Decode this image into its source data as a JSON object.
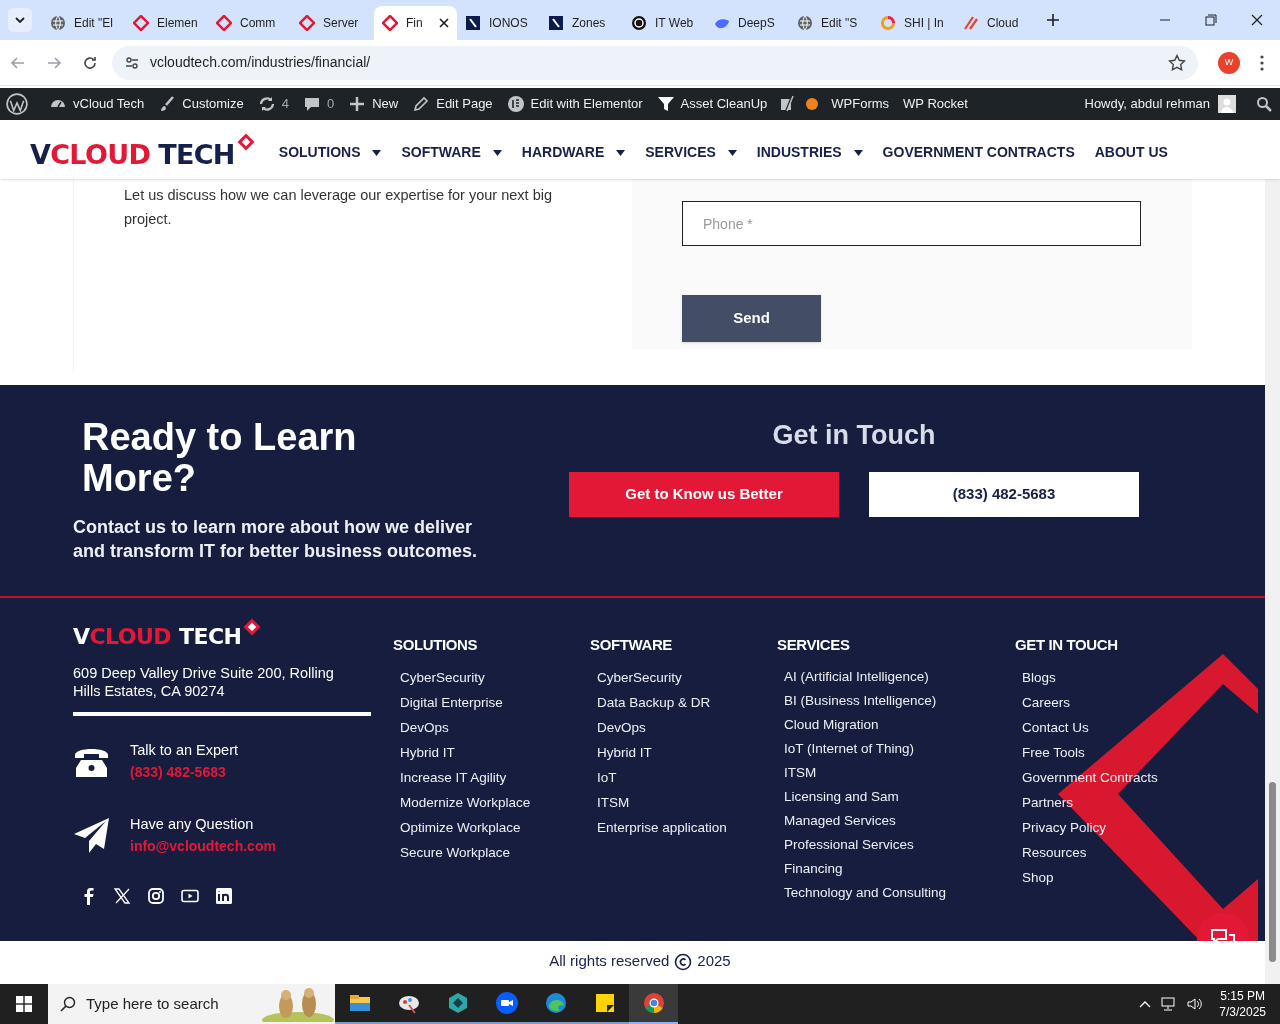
{
  "browser": {
    "tabs": [
      {
        "title": "Edit \"El",
        "selected": false
      },
      {
        "title": "Elemen",
        "selected": false
      },
      {
        "title": "Comm",
        "selected": false
      },
      {
        "title": "Server",
        "selected": false
      },
      {
        "title": "Fin",
        "selected": true
      },
      {
        "title": "IONOS",
        "selected": false
      },
      {
        "title": "Zones",
        "selected": false
      },
      {
        "title": "IT Web",
        "selected": false
      },
      {
        "title": "DeepS",
        "selected": false
      },
      {
        "title": "Edit \"S",
        "selected": false
      },
      {
        "title": "SHI | In",
        "selected": false
      },
      {
        "title": "Cloud",
        "selected": false
      }
    ],
    "url": "vcloudtech.com/industries/financial/",
    "profile": "W"
  },
  "admin_bar": {
    "items": [
      {
        "label": "vCloud Tech"
      },
      {
        "label": "Customize"
      },
      {
        "label": "4"
      },
      {
        "label": "0"
      },
      {
        "label": "New"
      },
      {
        "label": "Edit Page"
      },
      {
        "label": "Edit with Elementor"
      },
      {
        "label": "Asset CleanUp"
      },
      {
        "label": "WPForms"
      },
      {
        "label": "WP Rocket"
      }
    ],
    "greeting": "Howdy, abdul rehman"
  },
  "header": {
    "logo": [
      "V",
      "CLOUD",
      "TECH"
    ],
    "nav": [
      {
        "label": "SOLUTIONS",
        "dropdown": true
      },
      {
        "label": "SOFTWARE",
        "dropdown": true
      },
      {
        "label": "HARDWARE",
        "dropdown": true
      },
      {
        "label": "SERVICES",
        "dropdown": true
      },
      {
        "label": "INDUSTRIES",
        "dropdown": true
      },
      {
        "label": "GOVERNMENT CONTRACTS",
        "dropdown": false
      },
      {
        "label": "ABOUT US",
        "dropdown": false
      }
    ]
  },
  "contact": {
    "text": "Let us discuss how we can leverage our expertise for your next big project.",
    "phone_placeholder": "Phone *",
    "send": "Send"
  },
  "cta": {
    "heading": "Ready to Learn More?",
    "text": "Contact us to learn more about how we deliver and transform IT for better business outcomes.",
    "touch_heading": "Get in Touch",
    "primary_button": "Get to Know us Better",
    "phone_button": "(833) 482-5683"
  },
  "footer": {
    "logo": [
      "V",
      "CLOUD",
      "TECH"
    ],
    "address": "609 Deep Valley Drive Suite 200, Rolling Hills Estates, CA 90274",
    "contacts": [
      {
        "kind": "phone",
        "label": "Talk to an Expert",
        "value": "(833) 482-5683"
      },
      {
        "kind": "email",
        "label": "Have any Question",
        "value": "info@vcloudtech.com"
      }
    ],
    "columns": [
      {
        "heading": "SOLUTIONS",
        "links": [
          "CyberSecurity",
          "Digital Enterprise",
          "DevOps",
          "Hybrid IT",
          "Increase IT Agility",
          "Modernize Workplace",
          "Optimize Workplace",
          "Secure Workplace"
        ]
      },
      {
        "heading": "SOFTWARE",
        "links": [
          "CyberSecurity",
          "Data Backup & DR",
          "DevOps",
          "Hybrid IT",
          "IoT",
          "ITSM",
          "Enterprise application"
        ]
      },
      {
        "heading": "SERVICES",
        "links": [
          "AI (Artificial Intelligence)",
          "BI (Business Intelligence)",
          "Cloud Migration",
          "IoT (Internet of Thing)",
          "ITSM",
          "Licensing and Sam",
          "Managed Services",
          "Professional Services",
          "Financing",
          "Technology and Consulting"
        ]
      },
      {
        "heading": "GET IN TOUCH",
        "links": [
          "Blogs",
          "Careers",
          "Contact Us",
          "Free Tools",
          "Government Contracts",
          "Partners",
          "Privacy Policy",
          "Resources",
          "Shop"
        ]
      }
    ]
  },
  "copyright": {
    "text": "All rights reserved",
    "year": "2025"
  },
  "taskbar": {
    "search_placeholder": "Type here to search",
    "time": "5:15 PM",
    "date": "7/3/2025"
  }
}
